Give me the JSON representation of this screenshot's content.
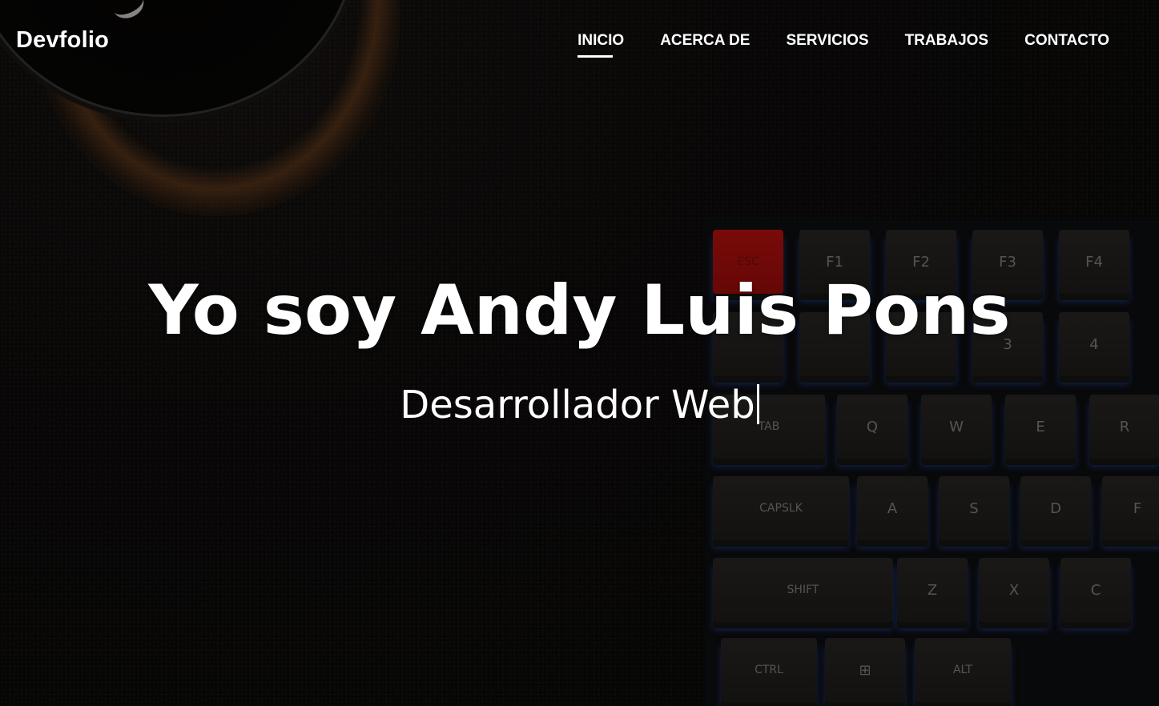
{
  "header": {
    "brand": "Devfolio",
    "nav": [
      {
        "label": "INICIO",
        "active": true
      },
      {
        "label": "ACERCA DE",
        "active": false
      },
      {
        "label": "SERVICIOS",
        "active": false
      },
      {
        "label": "TRABAJOS",
        "active": false
      },
      {
        "label": "CONTACTO",
        "active": false
      }
    ]
  },
  "hero": {
    "title": "Yo soy Andy Luis Pons",
    "subtitle": "Desarrollador Web",
    "background": "dark desk with coffee cup and keyboard",
    "keys": [
      "ESC",
      "F1",
      "F2",
      "F3",
      "F4",
      "3",
      "4",
      "TAB",
      "Q",
      "W",
      "E",
      "R",
      "CAPSLK",
      "A",
      "S",
      "D",
      "F",
      "SHIFT",
      "Z",
      "X",
      "C",
      "CTRL",
      "ALT"
    ]
  },
  "colors": {
    "text": "#ffffff",
    "esc_key": "#c3120f",
    "key_glow": "#2a5ad0"
  }
}
